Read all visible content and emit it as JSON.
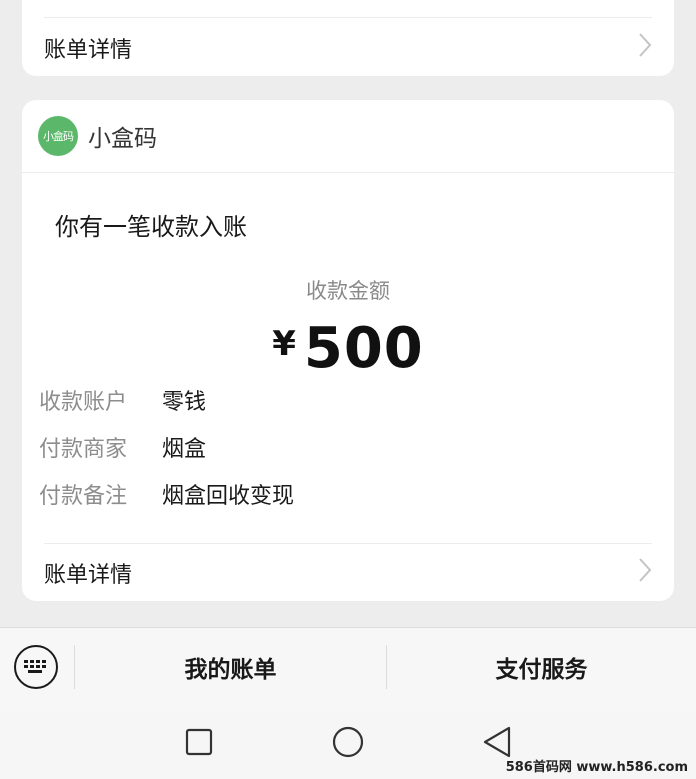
{
  "top_card": {
    "detail_label": "账单详情"
  },
  "notification": {
    "app_logo_text": "小盒码",
    "app_name": "小盒码",
    "title": "你有一笔收款入账",
    "amount_label": "收款金额",
    "currency_symbol": "¥",
    "amount_value": "500",
    "details": [
      {
        "key": "收款账户",
        "value": "零钱"
      },
      {
        "key": "付款商家",
        "value": "烟盒"
      },
      {
        "key": "付款备注",
        "value": "烟盒回收变现"
      }
    ],
    "detail_label": "账单详情"
  },
  "bottom_bar": {
    "keyboard_icon": "keyboard-icon",
    "tabs": [
      {
        "label": "我的账单"
      },
      {
        "label": "支付服务"
      }
    ]
  },
  "nav": {
    "icons": [
      "square-recent-icon",
      "circle-home-icon",
      "triangle-back-icon"
    ]
  },
  "watermark": "586首码网 www.h586.com",
  "colors": {
    "background": "#ededed",
    "card": "#ffffff",
    "logo_green": "#5bb86b",
    "muted_text": "#8d8d8d"
  }
}
